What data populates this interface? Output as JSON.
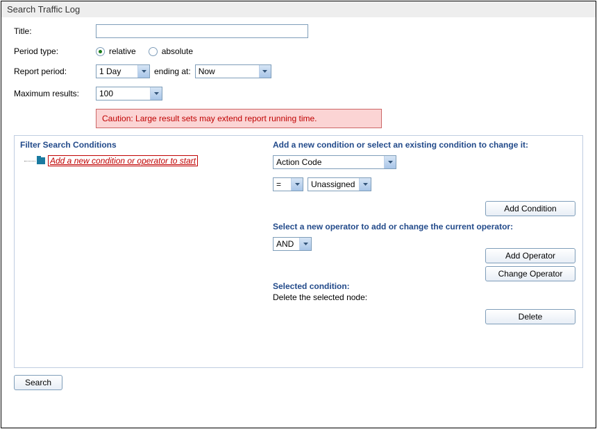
{
  "window": {
    "title": "Search Traffic Log"
  },
  "form": {
    "title_label": "Title:",
    "title_value": "",
    "period_type_label": "Period type:",
    "period_type_relative": "relative",
    "period_type_absolute": "absolute",
    "report_period_label": "Report period:",
    "report_period_value": "1 Day",
    "ending_at_label": "ending at:",
    "ending_at_value": "Now",
    "max_results_label": "Maximum results:",
    "max_results_value": "100",
    "caution": "Caution: Large result sets may extend report running time."
  },
  "left": {
    "heading": "Filter Search Conditions",
    "start_hint": "Add a new condition or operator to start"
  },
  "right": {
    "add_condition_heading": "Add a new condition or select an existing condition to change it:",
    "condition_field": "Action Code",
    "condition_operator": "=",
    "condition_value": "Unassigned",
    "add_condition_btn": "Add Condition",
    "operator_heading": "Select a new operator to add or change the current operator:",
    "operator_value": "AND",
    "add_operator_btn": "Add Operator",
    "change_operator_btn": "Change Operator",
    "selected_condition_heading": "Selected condition:",
    "delete_hint": "Delete the selected node:",
    "delete_btn": "Delete"
  },
  "search_btn": "Search"
}
